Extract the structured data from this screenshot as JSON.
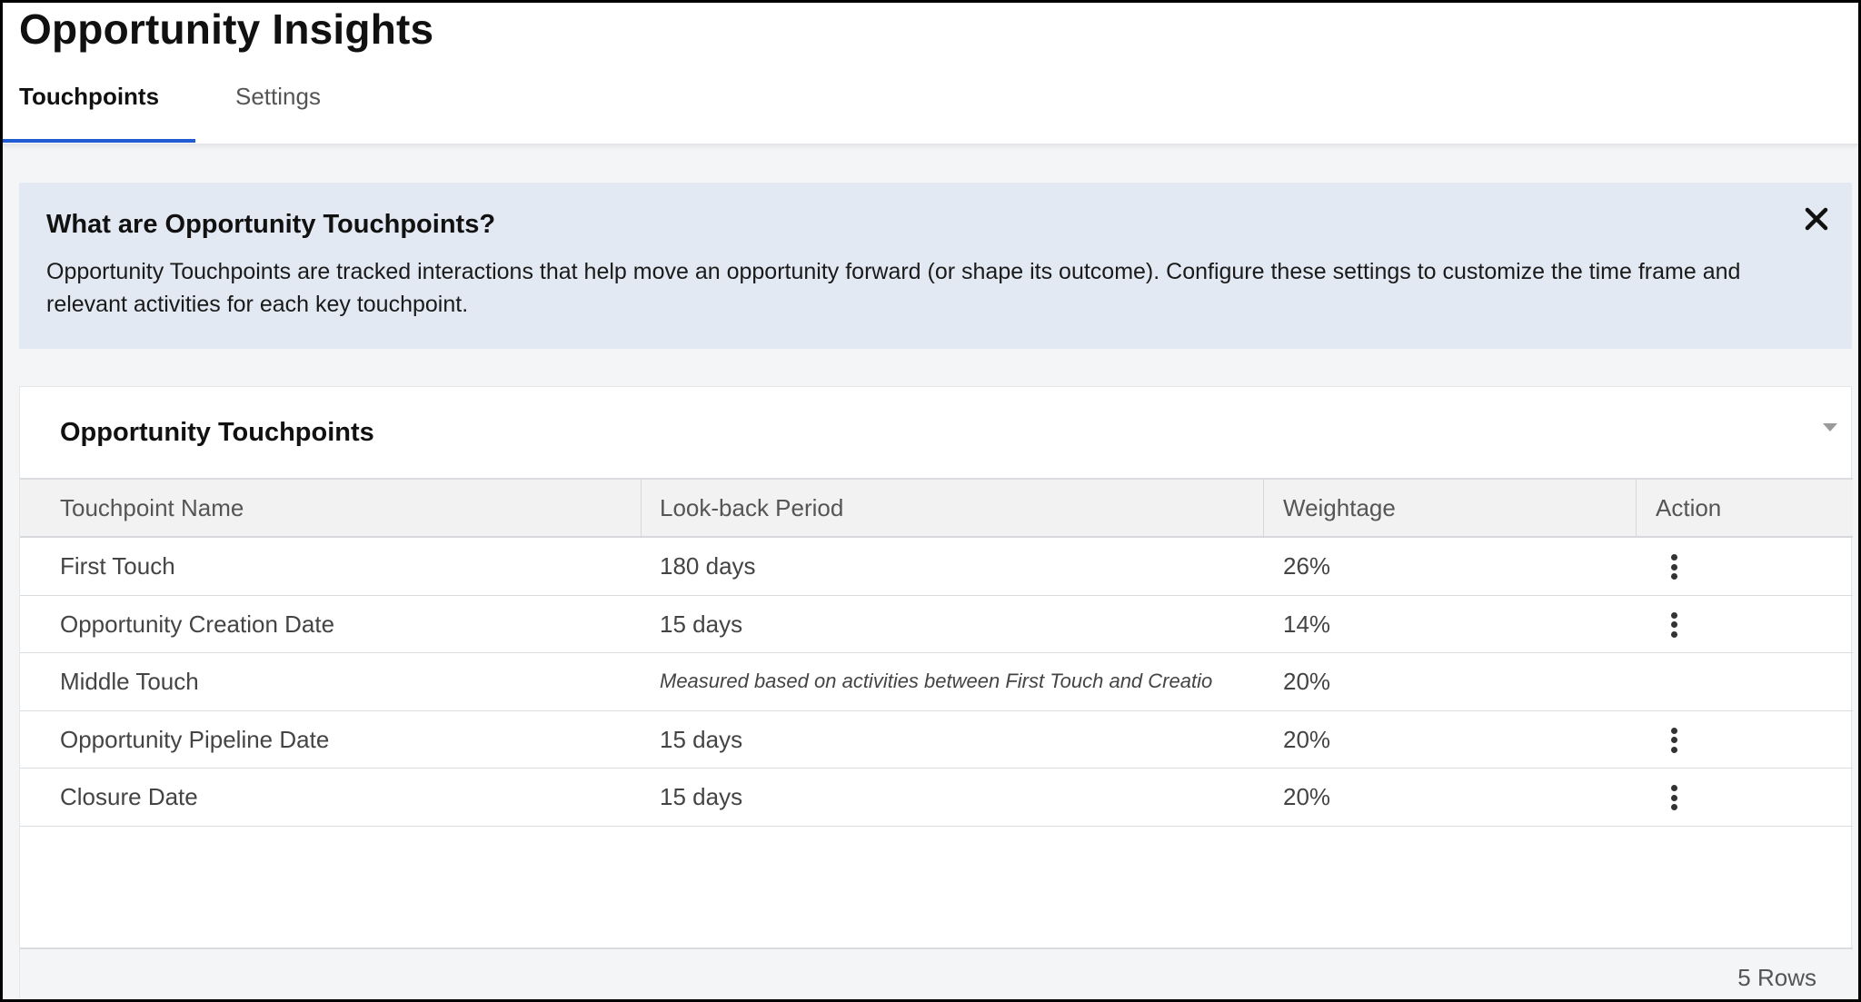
{
  "page": {
    "title": "Opportunity Insights"
  },
  "tabs": [
    {
      "label": "Touchpoints",
      "active": true
    },
    {
      "label": "Settings",
      "active": false
    }
  ],
  "info_banner": {
    "title": "What are Opportunity Touchpoints?",
    "body": "Opportunity Touchpoints are tracked interactions that help move an opportunity forward (or shape its outcome). Configure these settings to customize the time frame and relevant activities for each key touchpoint.",
    "close_icon": "close-icon"
  },
  "card": {
    "title": "Opportunity Touchpoints",
    "columns": [
      "Touchpoint Name",
      "Look-back Period",
      "Weightage",
      "Action"
    ],
    "rows": [
      {
        "name": "First Touch",
        "lookback": "180 days",
        "weightage": "26%",
        "has_action": true
      },
      {
        "name": "Opportunity Creation Date",
        "lookback": "15 days",
        "weightage": "14%",
        "has_action": true
      },
      {
        "name": "Middle Touch",
        "lookback": "Measured based on activities between First Touch and Creatio",
        "weightage": "20%",
        "has_action": false
      },
      {
        "name": "Opportunity Pipeline Date",
        "lookback": "15 days",
        "weightage": "20%",
        "has_action": true
      },
      {
        "name": "Closure Date",
        "lookback": "15 days",
        "weightage": "20%",
        "has_action": true
      }
    ],
    "footer": {
      "row_count": "5 Rows"
    }
  },
  "colors": {
    "accent": "#1f5bd1",
    "banner_bg": "#e3e9f2",
    "header_bg": "#f2f2f2"
  }
}
